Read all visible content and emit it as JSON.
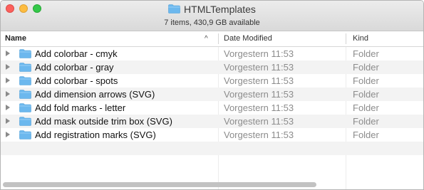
{
  "window": {
    "title": "HTMLTemplates",
    "status": "7 items, 430,9 GB available",
    "title_icon": "folder-icon"
  },
  "columns": {
    "name": "Name",
    "date_modified": "Date Modified",
    "kind": "Kind",
    "sort_indicator": "^"
  },
  "rows": [
    {
      "name": "Add colorbar - cmyk",
      "date": "Vorgestern 11:53",
      "kind": "Folder"
    },
    {
      "name": "Add colorbar - gray",
      "date": "Vorgestern 11:53",
      "kind": "Folder"
    },
    {
      "name": "Add colorbar - spots",
      "date": "Vorgestern 11:53",
      "kind": "Folder"
    },
    {
      "name": "Add dimension arrows (SVG)",
      "date": "Vorgestern 11:53",
      "kind": "Folder"
    },
    {
      "name": "Add fold marks - letter",
      "date": "Vorgestern 11:53",
      "kind": "Folder"
    },
    {
      "name": "Add mask outside trim box (SVG)",
      "date": "Vorgestern 11:53",
      "kind": "Folder"
    },
    {
      "name": "Add registration marks (SVG)",
      "date": "Vorgestern 11:53",
      "kind": "Folder"
    }
  ],
  "colors": {
    "folder": "#6cb8ee",
    "close": "#fc605c",
    "minimize": "#fdbc40",
    "zoom": "#34c84a"
  }
}
